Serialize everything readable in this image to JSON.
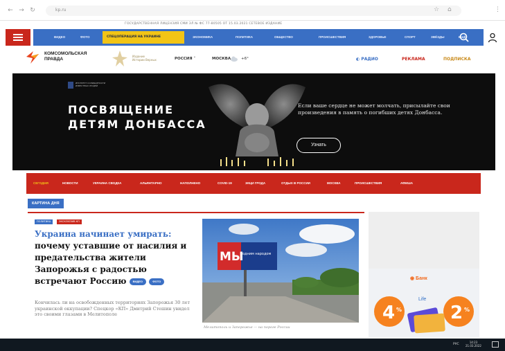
{
  "browser": {
    "url": "kp.ru",
    "back": "←",
    "forward": "→",
    "reload": "↻",
    "home": "⌂",
    "bookmark": "☆",
    "menu": "⋮"
  },
  "ticker": "ГОСУДАРСТВЕННАЯ ЛИЦЕНЗИЯ СМИ ЭЛ № ФС 77-80505 ОТ 15.03.2021 СЕТЕВОЕ ИЗДАНИЕ",
  "topnav": {
    "items": [
      "ВИДЕО",
      "ФОТО",
      "ЭКОНОМИКА",
      "ПОЛИТИКА",
      "ОБЩЕСТВО",
      "ПРОИСШЕСТВИЯ",
      "ЗДОРОВЬЕ",
      "СПОРТ",
      "ЗВЁЗДЫ",
      "ЕЩЁ"
    ],
    "highlight": "СПЕЦОПЕРАЦИЯ НА УКРАИНЕ"
  },
  "logo": {
    "line1": "КОМСОМОЛЬСКАЯ",
    "line2": "ПРАВДА",
    "sub1": "Издание",
    "sub2": "Истории Верных"
  },
  "region": {
    "country": "РОССИЯ ˅",
    "city": "МОСКВА",
    "temp": "+6°"
  },
  "right_links": {
    "radio": "◐ РАДИО",
    "ads": "РЕКЛАМА",
    "subscribe": "ПОДПИСКА"
  },
  "banner": {
    "small_caption": "ИНСТИТУТ СОЛИДАРНОСТИ ИЗВЕСТНЫХ ЛЮДЕЙ",
    "title_line1": "ПОСВЯЩЕНИЕ",
    "title_line2": "ДЕТЯМ ДОНБАССА",
    "desc": "Если ваше сердце не может молчать, присылайте свои произведения в память о погибших детях Донбасса.",
    "button": "Узнать"
  },
  "subnav": {
    "items": [
      "СЕГОДНЯ",
      "НОВОСТИ",
      "УКРАИНА СВОДКА",
      "АЛЬЯНТАРНО",
      "НАПОЛНЕНО",
      "COVID-19",
      "ЭКЦИ ГРОДА",
      "ОТДЫХ В РОССИИ",
      "МОСКВА",
      "ПРОИСШЕСТВИЯ",
      "АФИША"
    ]
  },
  "section_tag": "КАРТИНА ДНЯ",
  "article": {
    "tag1": "ПОЛИТИКА",
    "tag2": "ЭКСКЛЮЗИВ КП",
    "headline_blue": "Украина начинает умирать:",
    "headline_rest": "почему уставшие от насилия и предательства жители Запорожья с радостью встречают Россию",
    "pill1": "ВИДЕО",
    "pill2": "ФОТО",
    "lead": "Кончилась ли на освобожденных территориях Запорожья 30 лет украинской оккупации? Спецкор «КП» Дмитрий Стешин увидел это своими глазами в Мелитополе"
  },
  "photo": {
    "billboard_big": "МЫ",
    "billboard_small": "одним народом",
    "caption": "Мелитополь и Запорожье — на пороге России"
  },
  "ad": {
    "brand": "◉ Банк",
    "left_num": "4",
    "right_num": "2",
    "left_pct": "%",
    "right_pct": "%",
    "mid": "Life"
  },
  "taskbar": {
    "lang": "РУС",
    "time": "14:23",
    "date": "21.03.2022"
  },
  "colors": {
    "brand_red": "#c9271c",
    "nav_blue": "#3a6fc4",
    "highlight_yellow": "#f2c416"
  }
}
